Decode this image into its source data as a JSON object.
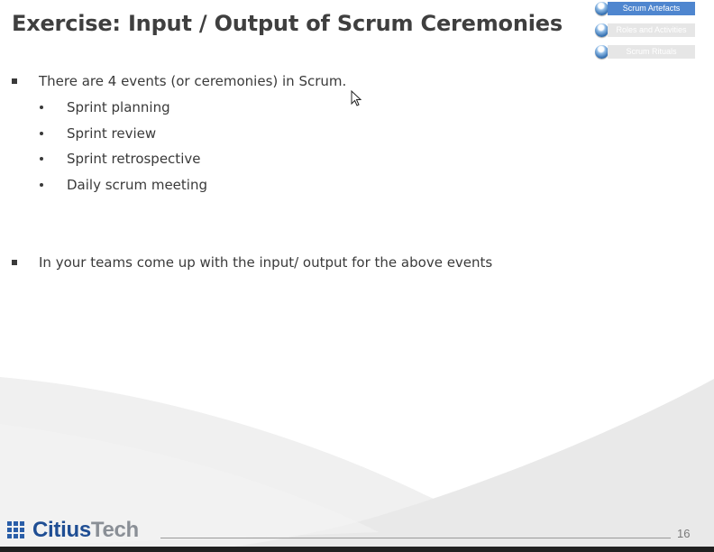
{
  "slide": {
    "title": "Exercise: Input / Output of Scrum Ceremonies",
    "page_number": "16"
  },
  "nav": {
    "items": [
      {
        "label": "Scrum Artefacts",
        "active": true
      },
      {
        "label": "Roles and Activities",
        "active": false
      },
      {
        "label": "Scrum Rituals",
        "active": false
      }
    ]
  },
  "content": {
    "intro": "There are 4 events (or ceremonies) in Scrum.",
    "events": [
      "Sprint planning",
      "Sprint review",
      "Sprint retrospective",
      "Daily scrum meeting"
    ],
    "task": "In your teams come up with the input/ output for the above events"
  },
  "logo": {
    "part1": "Citius",
    "part2": "Tech"
  },
  "colors": {
    "accent": "#4f86cf",
    "title": "#3f3f3f",
    "logo_blue": "#1f4e94",
    "logo_gray": "#8a8f96"
  },
  "icons": {
    "cursor": "mouse-pointer-icon",
    "nav_bullet": "orb-icon",
    "logo_mark": "grid-logo-icon"
  }
}
